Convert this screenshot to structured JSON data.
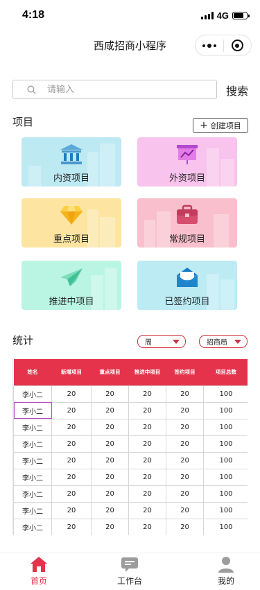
{
  "status_bar": {
    "time": "4:18",
    "network": "4G"
  },
  "navbar": {
    "title": "西咸招商小程序"
  },
  "search": {
    "placeholder": "请输入",
    "button_label": "搜索"
  },
  "projects": {
    "section_title": "项目",
    "create_label": "创建项目",
    "cards": [
      {
        "label": "内资项目",
        "bg": "#bde9f3",
        "icon": "bank-icon"
      },
      {
        "label": "外资项目",
        "bg": "#f8c3ec",
        "icon": "chart-board-icon"
      },
      {
        "label": "重点项目",
        "bg": "#fde5a1",
        "icon": "diamond-icon"
      },
      {
        "label": "常规项目",
        "bg": "#f9bfcc",
        "icon": "briefcase-icon"
      },
      {
        "label": "推进中项目",
        "bg": "#baf5e3",
        "icon": "paper-plane-icon"
      },
      {
        "label": "已签约项目",
        "bg": "#bcebf4",
        "icon": "envelope-icon"
      }
    ]
  },
  "stats": {
    "section_title": "统计",
    "period_select": "周",
    "org_select": "招商局",
    "columns": [
      "姓名",
      "新增项目",
      "重点项目",
      "推进中项目",
      "签约项目",
      "项目总数"
    ],
    "rows": [
      [
        "李小二",
        "20",
        "20",
        "20",
        "20",
        "100"
      ],
      [
        "李小二",
        "20",
        "20",
        "20",
        "20",
        "100"
      ],
      [
        "李小二",
        "20",
        "20",
        "20",
        "20",
        "100"
      ],
      [
        "李小二",
        "20",
        "20",
        "20",
        "20",
        "100"
      ],
      [
        "李小二",
        "20",
        "20",
        "20",
        "20",
        "100"
      ],
      [
        "李小二",
        "20",
        "20",
        "20",
        "20",
        "100"
      ],
      [
        "李小二",
        "20",
        "20",
        "20",
        "20",
        "100"
      ],
      [
        "李小二",
        "20",
        "20",
        "20",
        "20",
        "100"
      ],
      [
        "李小二",
        "20",
        "20",
        "20",
        "20",
        "100"
      ]
    ]
  },
  "tabbar": {
    "items": [
      {
        "label": "首页",
        "icon": "home-icon",
        "active": true
      },
      {
        "label": "工作台",
        "icon": "chat-icon",
        "active": false
      },
      {
        "label": "我的",
        "icon": "user-icon",
        "active": false
      }
    ]
  },
  "colors": {
    "accent": "#e5334b",
    "border_accent": "#d1303f"
  }
}
